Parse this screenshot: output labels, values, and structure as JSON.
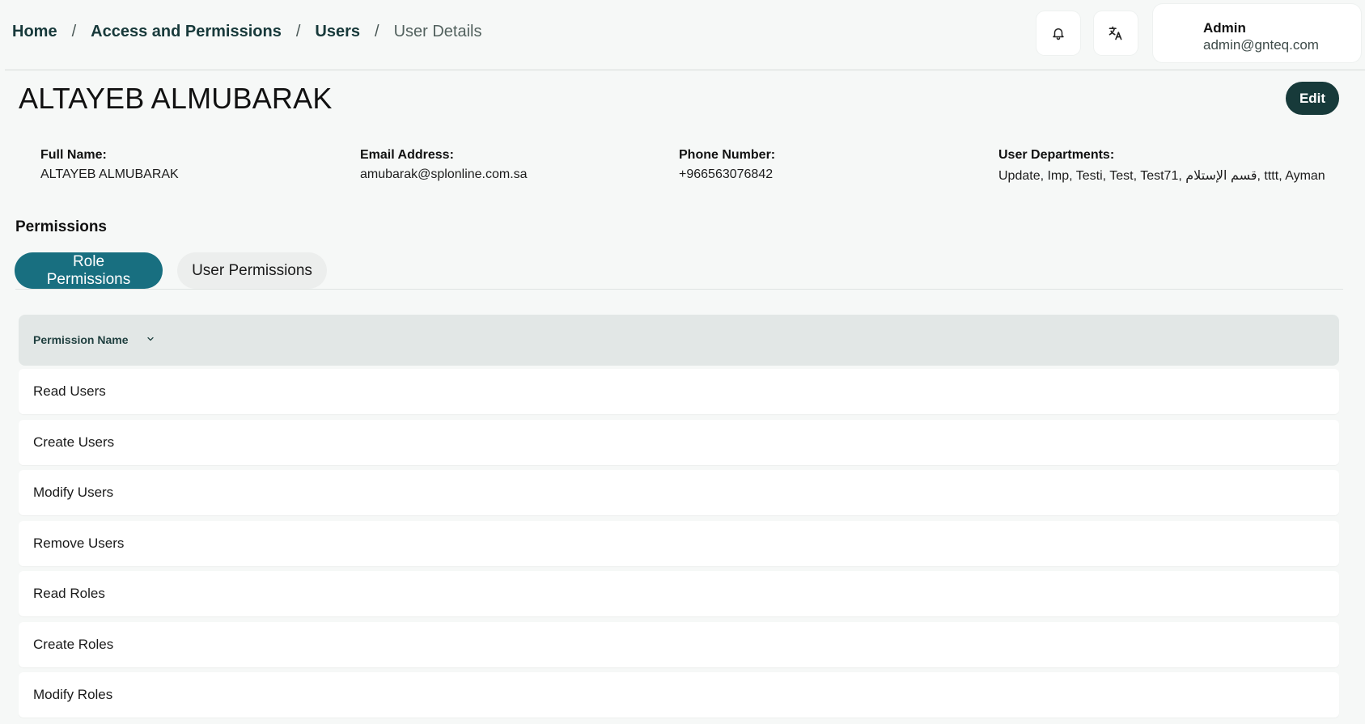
{
  "breadcrumb": {
    "items": [
      "Home",
      "Access and Permissions",
      "Users"
    ],
    "current": "User Details",
    "separator": "/"
  },
  "header": {
    "notifications_icon": "bell-icon",
    "language_icon": "translate-icon",
    "user": {
      "name": "Admin",
      "email": "admin@gnteq.com"
    }
  },
  "user": {
    "title": "ALTAYEB ALMUBARAK",
    "edit_label": "Edit",
    "fields": [
      {
        "label": "Full Name:",
        "value": "ALTAYEB ALMUBARAK"
      },
      {
        "label": "Email Address:",
        "value": "amubarak@splonline.com.sa"
      },
      {
        "label": "Phone Number:",
        "value": "+966563076842"
      },
      {
        "label": "User Departments:",
        "value": "Update, Imp, Testi, Test, Test71, قسم الإستلام, tttt, Ayman"
      }
    ]
  },
  "permissions": {
    "title": "Permissions",
    "tabs": [
      {
        "label": "Role Permissions",
        "active": true
      },
      {
        "label": "User Permissions",
        "active": false
      }
    ],
    "table": {
      "column": "Permission Name",
      "rows": [
        "Read Users",
        "Create Users",
        "Modify Users",
        "Remove Users",
        "Read Roles",
        "Create Roles",
        "Modify Roles"
      ]
    }
  },
  "colors": {
    "primary_dark": "#173a3a",
    "tab_active": "#186f80",
    "header_bg": "#e2e7e6",
    "page_bg": "#f6f8f7"
  }
}
